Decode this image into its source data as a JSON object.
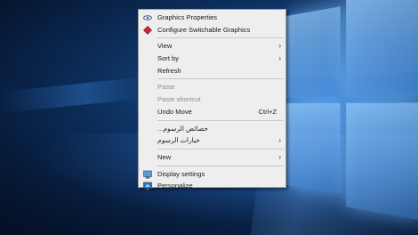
{
  "context_menu": {
    "items": [
      {
        "label": "Graphics Properties",
        "icon": "intel-graphics-icon"
      },
      {
        "label": "Configure Switchable Graphics",
        "icon": "switchable-graphics-diamond-icon"
      },
      {
        "label": "View",
        "submenu": true
      },
      {
        "label": "Sort by",
        "submenu": true
      },
      {
        "label": "Refresh"
      },
      {
        "label": "Paste",
        "disabled": true
      },
      {
        "label": "Paste shortcut",
        "disabled": true
      },
      {
        "label": "Undo Move",
        "shortcut": "Ctrl+Z"
      },
      {
        "label": "خصائص الرسوم..."
      },
      {
        "label": "خيارات الرسوم",
        "submenu": true
      },
      {
        "label": "New",
        "submenu": true
      },
      {
        "label": "Display settings",
        "icon": "display-settings-icon"
      },
      {
        "label": "Personalize",
        "icon": "personalize-icon"
      }
    ],
    "chevron_glyph": "›"
  },
  "colors": {
    "menu_background": "#eeeeee",
    "menu_text": "#1a1a1a",
    "disabled_text": "#8c8c8c",
    "desktop_blue": "#0b2a55"
  }
}
